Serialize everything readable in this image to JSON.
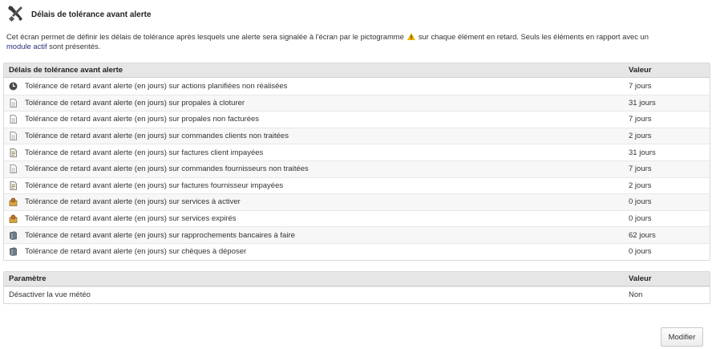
{
  "header": {
    "title": "Délais de tolérance avant alerte",
    "icon": "tools-icon"
  },
  "intro": {
    "text_before": "Cet écran permet de définir les délais de tolérance après lesquels une alerte sera signalée à l'écran par le pictogramme",
    "text_after": "sur chaque élément en retard. Seuls les éléments en rapport avec un",
    "link": "module actif",
    "text_end": "sont présentés."
  },
  "delays": {
    "header_label": "Délais de tolérance avant alerte",
    "header_value": "Valeur",
    "rows": [
      {
        "label": "Tolérance de retard avant alerte (en jours) sur actions planifiées non réalisées",
        "value": "7 jours",
        "icon": "clock-icon"
      },
      {
        "label": "Tolérance de retard avant alerte (en jours) sur propales à cloturer",
        "value": "31 jours",
        "icon": "document-icon"
      },
      {
        "label": "Tolérance de retard avant alerte (en jours) sur propales non facturées",
        "value": "7 jours",
        "icon": "document-icon"
      },
      {
        "label": "Tolérance de retard avant alerte (en jours) sur commandes clients non traitées",
        "value": "2 jours",
        "icon": "document-icon"
      },
      {
        "label": "Tolérance de retard avant alerte (en jours) sur factures client impayées",
        "value": "31 jours",
        "icon": "invoice-icon"
      },
      {
        "label": "Tolérance de retard avant alerte (en jours) sur commandes fournisseurs non traitées",
        "value": "7 jours",
        "icon": "document-icon"
      },
      {
        "label": "Tolérance de retard avant alerte (en jours) sur factures fournisseur impayées",
        "value": "2 jours",
        "icon": "invoice-icon"
      },
      {
        "label": "Tolérance de retard avant alerte (en jours) sur services à activer",
        "value": "0 jours",
        "icon": "service-icon"
      },
      {
        "label": "Tolérance de retard avant alerte (en jours) sur services expirés",
        "value": "0 jours",
        "icon": "service-icon"
      },
      {
        "label": "Tolérance de retard avant alerte (en jours) sur rapprochements bancaires à faire",
        "value": "62 jours",
        "icon": "bank-icon"
      },
      {
        "label": "Tolérance de retard avant alerte (en jours) sur chèques à déposer",
        "value": "0 jours",
        "icon": "bank-icon"
      }
    ]
  },
  "params": {
    "header_label": "Paramètre",
    "header_value": "Valeur",
    "rows": [
      {
        "label": "Désactiver la vue météo",
        "value": "Non"
      }
    ]
  },
  "actions": {
    "modify_label": "Modifier"
  }
}
